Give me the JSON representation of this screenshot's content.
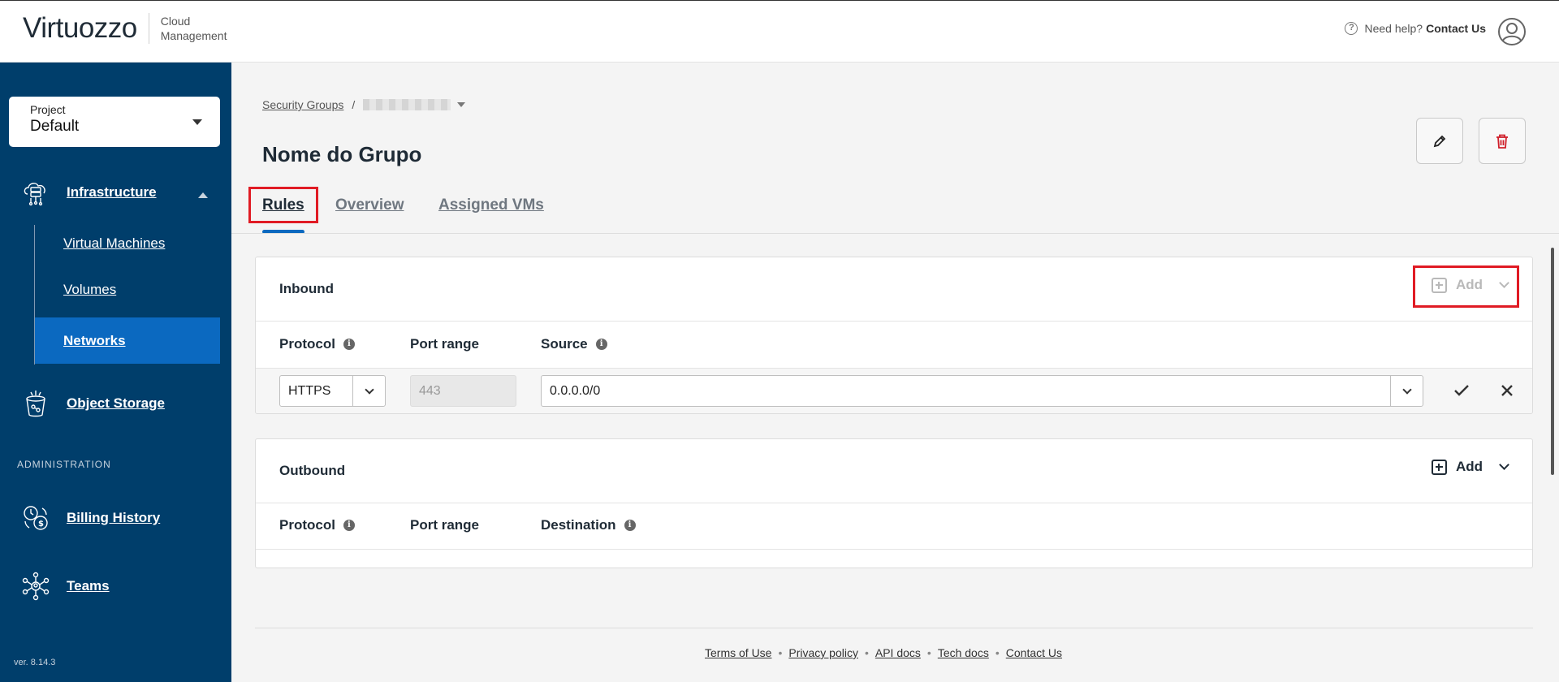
{
  "header": {
    "brand": "Virtuozzo",
    "brand_sub_line1": "Cloud",
    "brand_sub_line2": "Management",
    "help_text": "Need help?",
    "help_link": "Contact Us"
  },
  "sidebar": {
    "project_label": "Project",
    "project_value": "Default",
    "infrastructure": "Infrastructure",
    "sub_items": [
      {
        "label": "Virtual Machines"
      },
      {
        "label": "Volumes"
      },
      {
        "label": "Networks"
      }
    ],
    "object_storage": "Object Storage",
    "section_admin": "ADMINISTRATION",
    "billing_history": "Billing History",
    "teams": "Teams",
    "version": "ver. 8.14.3"
  },
  "page": {
    "breadcrumb_root": "Security Groups",
    "breadcrumb_sep": "/",
    "title": "Nome do Grupo"
  },
  "tabs": [
    {
      "label": "Rules"
    },
    {
      "label": "Overview"
    },
    {
      "label": "Assigned VMs"
    }
  ],
  "inbound": {
    "title": "Inbound",
    "add_label": "Add",
    "col_protocol": "Protocol",
    "col_port": "Port range",
    "col_source": "Source",
    "row": {
      "protocol": "HTTPS",
      "port": "443",
      "source": "0.0.0.0/0"
    }
  },
  "outbound": {
    "title": "Outbound",
    "add_label": "Add",
    "col_protocol": "Protocol",
    "col_port": "Port range",
    "col_destination": "Destination"
  },
  "footer": {
    "links": [
      "Terms of Use",
      "Privacy policy",
      "API docs",
      "Tech docs",
      "Contact Us"
    ]
  },
  "colors": {
    "sidebar_bg": "#003e6b",
    "active_nav": "#0b69c0",
    "highlight": "#e01b24",
    "delete_red": "#d0202b"
  }
}
